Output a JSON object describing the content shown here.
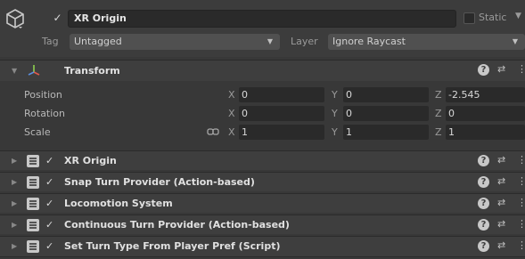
{
  "header": {
    "active": true,
    "name": "XR Origin",
    "static_label": "Static",
    "static_checked": false,
    "tag_label": "Tag",
    "tag_value": "Untagged",
    "layer_label": "Layer",
    "layer_value": "Ignore Raycast"
  },
  "transform": {
    "title": "Transform",
    "rows": [
      {
        "label": "Position",
        "x": "0",
        "y": "0",
        "z": "-2.545"
      },
      {
        "label": "Rotation",
        "x": "0",
        "y": "0",
        "z": "0"
      },
      {
        "label": "Scale",
        "x": "1",
        "y": "1",
        "z": "1"
      }
    ],
    "axis_labels": {
      "x": "X",
      "y": "Y",
      "z": "Z"
    }
  },
  "components": [
    {
      "title": "XR Origin",
      "enabled": true
    },
    {
      "title": "Snap Turn Provider (Action-based)",
      "enabled": true
    },
    {
      "title": "Locomotion System",
      "enabled": true
    },
    {
      "title": "Continuous Turn Provider (Action-based)",
      "enabled": true
    },
    {
      "title": "Set Turn Type From Player Pref (Script)",
      "enabled": true
    }
  ],
  "icons": {
    "check": "✓",
    "help": "?",
    "preset": "⇄",
    "more": "⋮",
    "fold": "▼",
    "fold_right": "▶"
  },
  "colors": {
    "background": "#383838",
    "field": "#2a2a2a",
    "row": "#3e3e3e"
  }
}
